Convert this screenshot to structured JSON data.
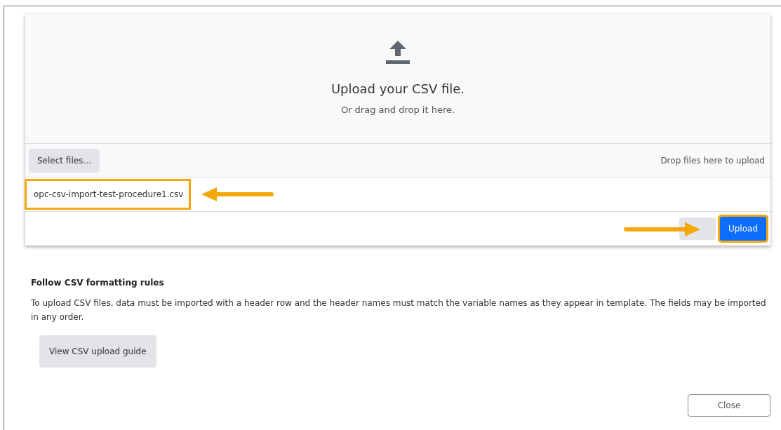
{
  "dropzone": {
    "title": "Upload your CSV file.",
    "subtitle": "Or drag and drop it here."
  },
  "toolbar": {
    "select_button": "Select files...",
    "hint": "Drop files here to upload"
  },
  "files": [
    {
      "name": "opc-csv-import-test-procedure1.csv",
      "highlighted": true
    }
  ],
  "actions": {
    "upload_button": {
      "label": "Upload",
      "highlighted": true
    }
  },
  "rules": {
    "heading": "Follow CSV formatting rules",
    "text": "To upload CSV files, data must be imported with a header row and the header names must match the variable names as they appear in template. The fields may be imported in any order.",
    "guide_button": "View CSV upload guide"
  },
  "close_button": "Close"
}
